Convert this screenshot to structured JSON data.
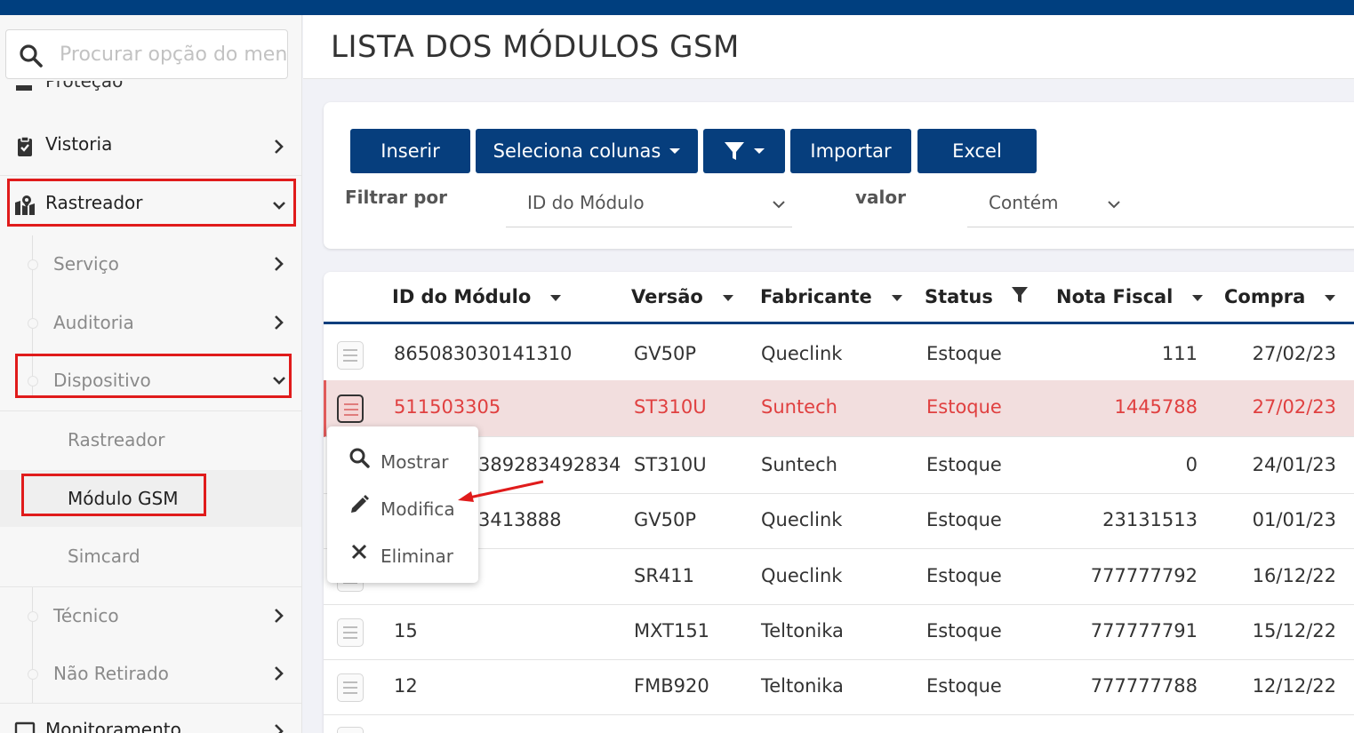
{
  "header": {
    "title": "LISTA DOS MÓDULOS GSM"
  },
  "search": {
    "placeholder": "Procurar opção do menu"
  },
  "sidebar": {
    "peek_label": "Proteção",
    "vistoria": "Vistoria",
    "rastreador": "Rastreador",
    "sub": {
      "servico": "Serviço",
      "auditoria": "Auditoria",
      "dispositivo": "Dispositivo",
      "tecnico": "Técnico",
      "nao_retirado": "Não Retirado"
    },
    "leaves": {
      "rastreador": "Rastreador",
      "modulo_gsm": "Módulo GSM",
      "simcard": "Simcard"
    },
    "monitoramento": "Monitoramento"
  },
  "toolbar": {
    "inserir": "Inserir",
    "seleciona_colunas": "Seleciona colunas",
    "importar": "Importar",
    "excel": "Excel"
  },
  "filter": {
    "filtrar_por_label": "Filtrar por",
    "field_value": "ID do Módulo",
    "valor_label": "valor",
    "operator_value": "Contém"
  },
  "table": {
    "columns": {
      "id": "ID do Módulo",
      "versao": "Versão",
      "fabricante": "Fabricante",
      "status": "Status",
      "nota_fiscal": "Nota Fiscal",
      "compra": "Compra"
    },
    "rows": [
      {
        "id": "865083030141310",
        "versao": "GV50P",
        "fabricante": "Queclink",
        "status": "Estoque",
        "nota_fiscal": "111",
        "compra": "27/02/23"
      },
      {
        "id": "511503305",
        "versao": "ST310U",
        "fabricante": "Suntech",
        "status": "Estoque",
        "nota_fiscal": "1445788",
        "compra": "27/02/23"
      },
      {
        "id": "389283492834",
        "versao": "ST310U",
        "fabricante": "Suntech",
        "status": "Estoque",
        "nota_fiscal": "0",
        "compra": "24/01/23"
      },
      {
        "id": "3413888",
        "versao": "GV50P",
        "fabricante": "Queclink",
        "status": "Estoque",
        "nota_fiscal": "23131513",
        "compra": "01/01/23"
      },
      {
        "id": "",
        "versao": "SR411",
        "fabricante": "Queclink",
        "status": "Estoque",
        "nota_fiscal": "777777792",
        "compra": "16/12/22"
      },
      {
        "id": "15",
        "versao": "MXT151",
        "fabricante": "Teltonika",
        "status": "Estoque",
        "nota_fiscal": "777777791",
        "compra": "15/12/22"
      },
      {
        "id": "12",
        "versao": "FMB920",
        "fabricante": "Teltonika",
        "status": "Estoque",
        "nota_fiscal": "777777788",
        "compra": "12/12/22"
      }
    ]
  },
  "context_menu": {
    "mostrar": "Mostrar",
    "modifica": "Modifica",
    "eliminar": "Eliminar"
  },
  "colors": {
    "primary": "#063e7d",
    "topbar": "#003f7f",
    "highlight": "#e01b1b",
    "selected_row_bg": "#f2dede",
    "selected_row_text": "#e04040"
  }
}
